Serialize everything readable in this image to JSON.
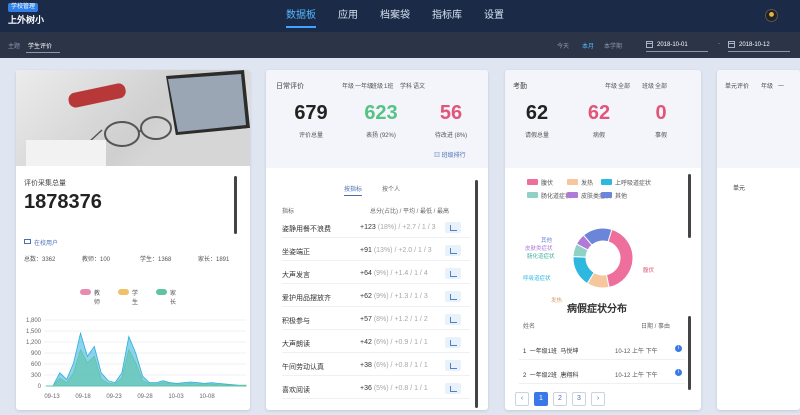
{
  "brand": {
    "badge": "学校管理",
    "name": "上外树小"
  },
  "nav": [
    "数据板",
    "应用",
    "档案袋",
    "指标库",
    "设置"
  ],
  "filter": {
    "label": "主题",
    "value": "学生评价",
    "ranges": [
      "今天",
      "本月",
      "本学期"
    ],
    "active_range": "本月",
    "date_from": "2018-10-01",
    "date_sep": "-",
    "date_to": "2018-10-12"
  },
  "collection": {
    "title": "评价采集总量",
    "total": "1878376",
    "online_label": "在校用户",
    "counts": [
      "总数：3362",
      "教师：100",
      "学生：1368",
      "家长：1891"
    ],
    "legend": [
      {
        "label": "教师",
        "color": "#e98bb0"
      },
      {
        "label": "学生",
        "color": "#f0c06a"
      },
      {
        "label": "家长",
        "color": "#5fc4a3"
      }
    ],
    "y_ticks": [
      "1,800",
      "1,500",
      "1,200",
      "900",
      "600",
      "300",
      "0"
    ],
    "x_ticks": [
      "09-13",
      "09-18",
      "09-23",
      "09-28",
      "10-03",
      "10-08"
    ]
  },
  "daily_eval": {
    "title": "日常评价",
    "filters": [
      "年级",
      "一年级",
      "班级",
      "1班",
      "学科",
      "语文"
    ],
    "stats": [
      {
        "value": "679",
        "label": "评价总量",
        "color": "#222222"
      },
      {
        "value": "623",
        "label": "表扬 (92%)",
        "color": "#55c384"
      },
      {
        "value": "56",
        "label": "待改进 (8%)",
        "color": "#e2557a"
      }
    ],
    "ranking_link": "班级排行",
    "tabs": [
      "按指标",
      "按个人"
    ],
    "table_header": [
      "指标",
      "总分(占比) / 平均 / 最低 / 最高"
    ],
    "rows": [
      {
        "name": "姿静用餐不浪费",
        "score": "+123",
        "rest": "(18%) / +2.7 / 1 / 3"
      },
      {
        "name": "坐姿端正",
        "score": "+91",
        "rest": "(13%) / +2.0 / 1 / 3"
      },
      {
        "name": "大声发言",
        "score": "+64",
        "rest": "(9%) / +1.4 / 1 / 4"
      },
      {
        "name": "爱护用品摆放齐",
        "score": "+62",
        "rest": "(9%) / +1.3 / 1 / 3"
      },
      {
        "name": "积极参与",
        "score": "+57",
        "rest": "(8%) / +1.2 / 1 / 2"
      },
      {
        "name": "大声朗读",
        "score": "+42",
        "rest": "(6%) / +0.9 / 1 / 1"
      },
      {
        "name": "午间劳动认真",
        "score": "+38",
        "rest": "(6%) / +0.8 / 1 / 1"
      },
      {
        "name": "喜欢阅读",
        "score": "+36",
        "rest": "(5%) / +0.8 / 1 / 1"
      }
    ]
  },
  "attendance": {
    "title": "考勤",
    "filters": [
      "年级",
      "全部",
      "班级",
      "全部"
    ],
    "stats": [
      {
        "value": "62",
        "label": "请假总量",
        "color": "#222222"
      },
      {
        "value": "62",
        "label": "病假",
        "color": "#e2557a"
      },
      {
        "value": "0",
        "label": "事假",
        "color": "#e2557a"
      }
    ],
    "legend": [
      {
        "label": "腹伏",
        "color": "#ee6f9b"
      },
      {
        "label": "发热",
        "color": "#f6c79c"
      },
      {
        "label": "上呼吸道症状",
        "color": "#2eb8e0"
      },
      {
        "label": "肠化道症状",
        "color": "#8fd1c4"
      },
      {
        "label": "皮肤类症状",
        "color": "#b07ad8"
      },
      {
        "label": "其他",
        "color": "#6b86d8"
      }
    ],
    "donut_labels": [
      {
        "label": "腹伏",
        "color": "#e2557a"
      },
      {
        "label": "发热",
        "color": "#d79c6a"
      },
      {
        "label": "呼吸道症状",
        "color": "#2eb8e0"
      },
      {
        "label": "肠化道症状",
        "color": "#3fb39f"
      },
      {
        "label": "皮肤类症状",
        "color": "#b07ad8"
      },
      {
        "label": "其他",
        "color": "#6b86d8"
      }
    ],
    "chart_title": "病假症状分布",
    "table_header": [
      "姓名",
      "日期 / 事由"
    ],
    "rows": [
      {
        "name": "1  一年级1班  马悦坤",
        "date": "10-12 上午 下午"
      },
      {
        "name": "2  一年级2班  唐翔科",
        "date": "10-12 上午 下午"
      }
    ],
    "pages": [
      "‹",
      "1",
      "2",
      "3",
      "›"
    ],
    "active_page": "1"
  },
  "unit_eval": {
    "title": "单元评价",
    "filter": "年级",
    "filter_value": "一",
    "row": "单元"
  }
}
